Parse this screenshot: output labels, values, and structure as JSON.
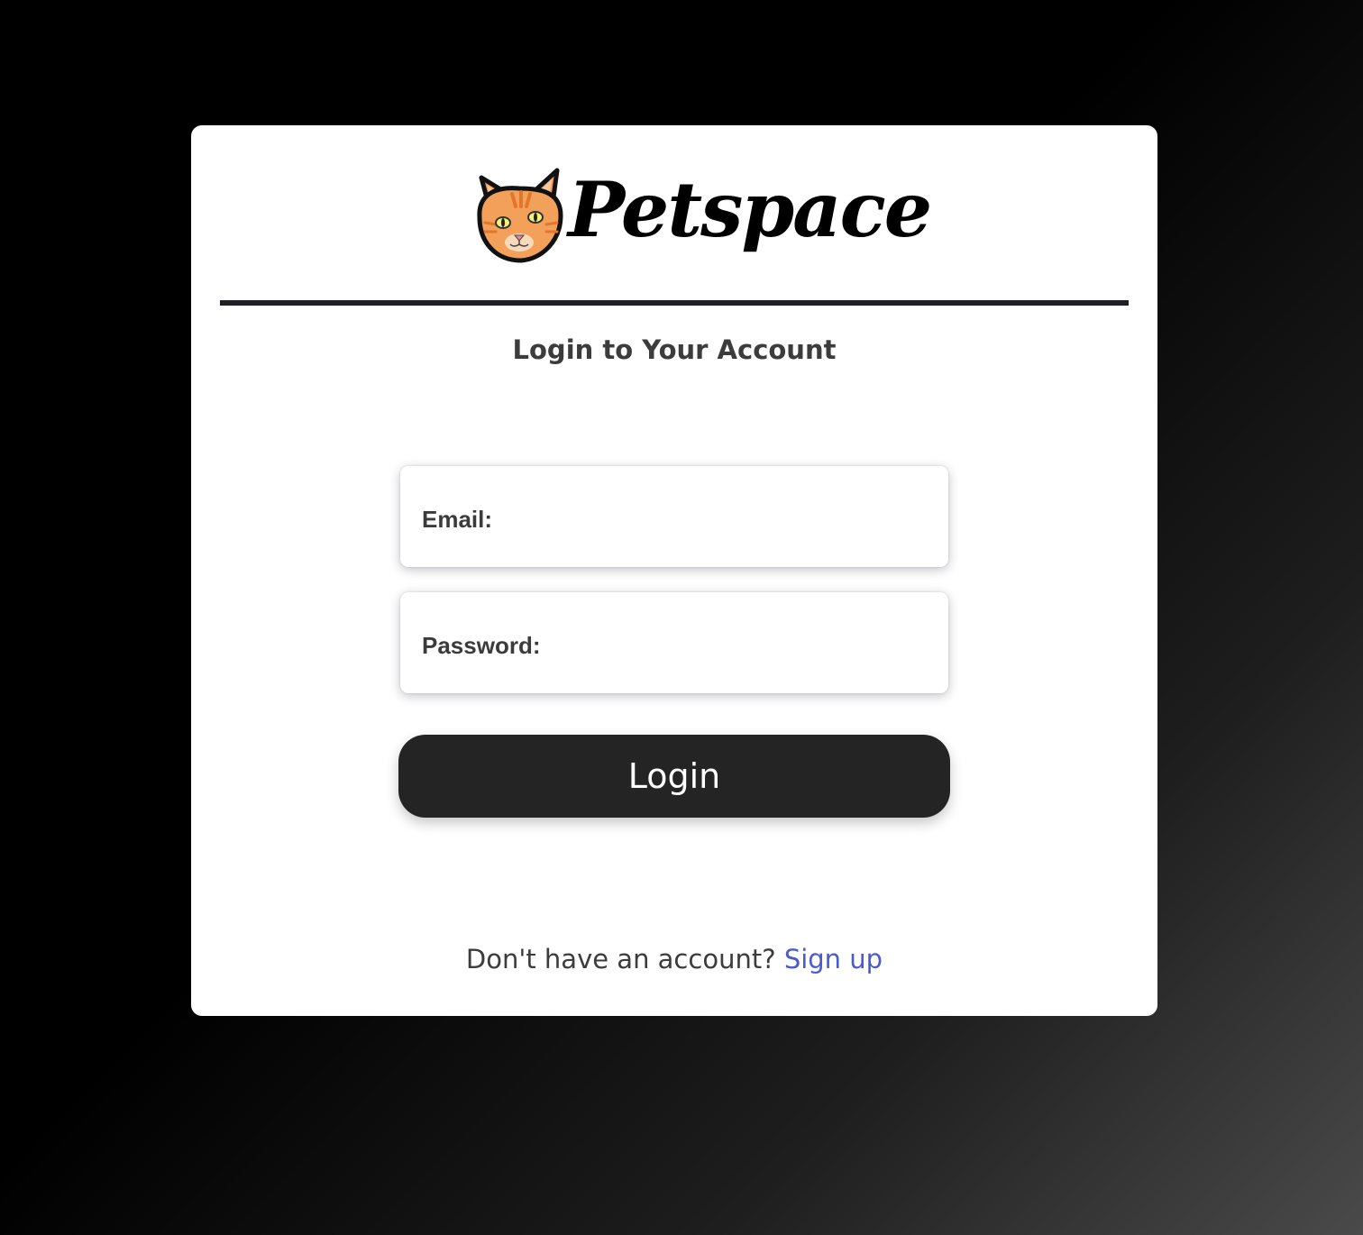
{
  "brand": {
    "name": "Petspace",
    "logo_icon": "cat-face-icon"
  },
  "heading": "Login to Your Account",
  "form": {
    "email_label": "Email:",
    "email_value": "",
    "password_label": "Password:",
    "password_value": "",
    "submit_label": "Login"
  },
  "footer": {
    "prompt": "Don't have an account?",
    "signup_link": "Sign up"
  },
  "colors": {
    "card_background": "#ffffff",
    "button_background": "#242424",
    "link": "#4a5bd0",
    "text": "#3c3c3c",
    "cat_orange": "#f2a05a"
  }
}
